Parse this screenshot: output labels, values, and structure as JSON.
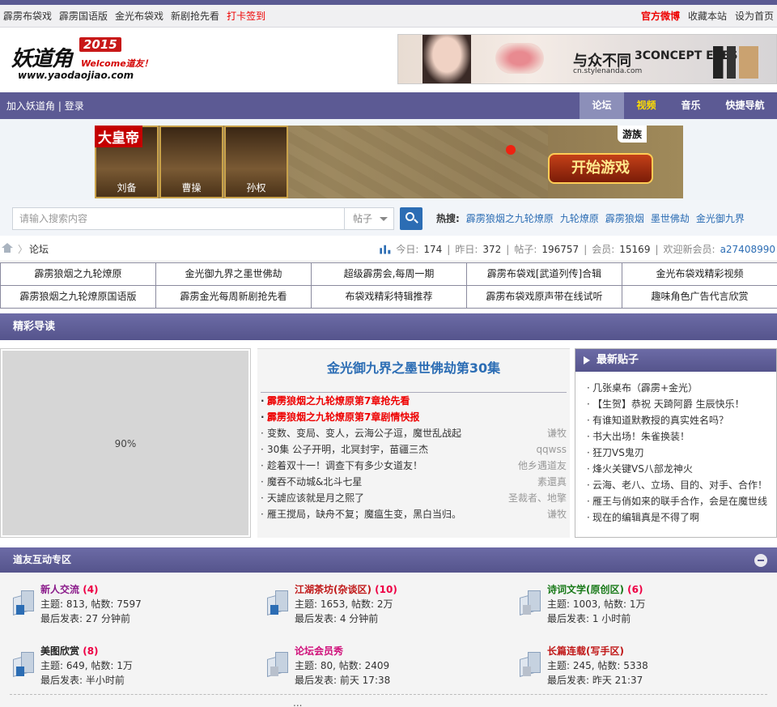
{
  "topbar": {
    "left_links": [
      "霹雳布袋戏",
      "霹雳国语版",
      "金光布袋戏",
      "新剧抢先看",
      "打卡签到"
    ],
    "checkin_color": "#e00000",
    "right_links": [
      "官方微博",
      "收藏本站",
      "设为首页"
    ]
  },
  "logo": {
    "name": "妖道角",
    "year": "2015",
    "welcome": "Welcome道友！",
    "url": "www.yaodaojiao.com"
  },
  "top_ad": {
    "headline": "与众不同",
    "brand": "3CONCEPT EYES",
    "site": "cn.stylenanda.com"
  },
  "nav": {
    "left": [
      "加入妖道角",
      "登录"
    ],
    "tabs": [
      "论坛",
      "视频",
      "音乐",
      "快捷导航"
    ],
    "active_tab": "论坛",
    "accent": "#5c5a94",
    "video_color": "#ffdd00"
  },
  "banner_ad": {
    "king_label": "大皇帝",
    "heroes": [
      "刘备",
      "曹操",
      "孙权"
    ],
    "cta": "开始游戏",
    "brand": "游族"
  },
  "search": {
    "placeholder": "请输入搜索内容",
    "type_value": "帖子",
    "hot_label": "热搜:",
    "hot_terms": [
      "霹雳狼烟之九轮燎原",
      "九轮燎原",
      "霹雳狼烟",
      "墨世佛劫",
      "金光御九界"
    ]
  },
  "breadcrumb": {
    "current": "论坛"
  },
  "stats": {
    "today_label": "今日:",
    "today": "174",
    "yesterday_label": "昨日:",
    "yesterday": "372",
    "posts_label": "帖子:",
    "posts": "196757",
    "members_label": "会员:",
    "members": "15169",
    "newest_label": "欢迎新会员:",
    "newest": "a27408990"
  },
  "quick_links": [
    "霹雳狼烟之九轮燎原",
    "金光御九界之墨世佛劫",
    "超级霹雳会,每周一期",
    "霹雳布袋戏[武道列传]合辑",
    "金光布袋戏精彩视频",
    "霹雳狼烟之九轮燎原国语版",
    "霹雳金光每周新剧抢先看",
    "布袋戏精彩特辑推荐",
    "霹雳布袋戏原声带在线试听",
    "趣味角色广告代言欣赏"
  ],
  "featured": {
    "section_title": "精彩导读",
    "image_label": "90%",
    "headline": "金光御九界之墨世佛劫第30集",
    "items": [
      {
        "title": "霹雳狼烟之九轮燎原第7章抢先看",
        "author": "",
        "hot": true
      },
      {
        "title": "霹雳狼烟之九轮燎原第7章剧情快报",
        "author": "",
        "hot": true
      },
      {
        "title": "变数、变局、变人，云海公子逗，魔世乱战起",
        "author": "谦牧",
        "hot": false
      },
      {
        "title": "30集 公子开明，北冥封宇，苗疆三杰",
        "author": "qqwss",
        "hot": false
      },
      {
        "title": "趁着双十一！调查下有多少女道友！",
        "author": "他乡遇道友",
        "hot": false
      },
      {
        "title": "魔吞不动城&北斗七星",
        "author": "素還真",
        "hot": false
      },
      {
        "title": "天謔应该就是月之熙了",
        "author": "圣裁者、地擎",
        "hot": false
      },
      {
        "title": "雁王搅局，缺舟不复；魔瘟生变，黑白当归。",
        "author": "谦牧",
        "hot": false
      }
    ]
  },
  "latest": {
    "title": "最新贴子",
    "items": [
      "几张桌布（霹雳+金光）",
      "【生贺】恭祝 天踦阿爵 生辰快乐！",
      "有谁知道默教授的真实姓名吗？",
      "书大出场！朱雀换装！",
      "狂刀VS鬼刃",
      "烽火关键VS八部龙神火",
      "云海、老八、立场、目的、对手、合作！",
      "雁王与俏如来的联手合作，会是在魔世线",
      "现在的编辑真是不得了啊"
    ]
  },
  "forum": {
    "section_title": "道友互动专区",
    "boards": [
      {
        "name": "新人交流",
        "count": "(4)",
        "stats": "主题: 813, 帖数: 7597",
        "last": "最后发表: 27 分钟前",
        "color": "#8a1a8a",
        "has_new": true
      },
      {
        "name": "江湖茶坊(杂谈区)",
        "count": "(10)",
        "stats": "主题: 1653, 帖数: 2万",
        "last": "最后发表: 4 分钟前",
        "color": "#c01818",
        "has_new": true
      },
      {
        "name": "诗词文学(原创区)",
        "count": "(6)",
        "stats": "主题: 1003, 帖数: 1万",
        "last": "最后发表: 1 小时前",
        "color": "#1a7a1a",
        "has_new": false
      },
      {
        "name": "美图欣赏",
        "count": "(8)",
        "stats": "主题: 649, 帖数: 1万",
        "last": "最后发表: 半小时前",
        "color": "#222222",
        "has_new": true
      },
      {
        "name": "论坛会员秀",
        "count": "",
        "stats": "主题: 80, 帖数: 2409",
        "last": "最后发表: 前天 17:38",
        "color": "#d0107a",
        "has_new": false
      },
      {
        "name": "长篇连载(写手区)",
        "count": "",
        "stats": "主题: 245, 帖数: 5338",
        "last": "最后发表: 昨天 21:37",
        "color": "#c01818",
        "has_new": false
      }
    ],
    "more": "..."
  }
}
